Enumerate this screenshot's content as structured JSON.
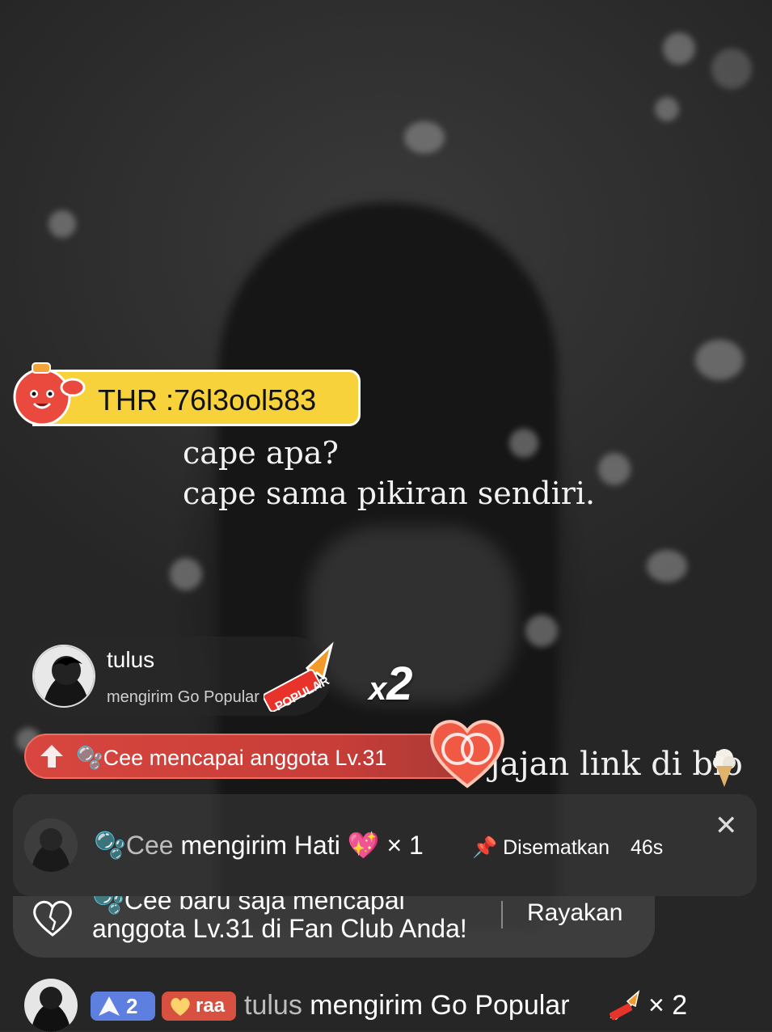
{
  "banner": {
    "text": "THR :76l3ool583"
  },
  "stream_caption": {
    "line1": "cape apa?",
    "line2": "cape sama pikiran sendiri.",
    "promo": "traktir jajan link di bio"
  },
  "gift_card": {
    "username": "tulus",
    "action": "mengirim Go Popular",
    "multiplier": "2",
    "multiplier_prefix": "x",
    "sticker_text": "POPULAR"
  },
  "level_up": {
    "text": "Cee mencapai anggota Lv.31"
  },
  "pinned": {
    "name": "Cee",
    "action": "mengirim Hati",
    "count": "× 1",
    "pinned_label": "Disematkan",
    "time": "46s"
  },
  "fan_club": {
    "line1": "Cee baru saja mencapai",
    "line2": "anggota Lv.31 di Fan Club Anda!",
    "button": "Rayakan"
  },
  "chat": {
    "level": "2",
    "fan_badge": "raa",
    "name": "tulus",
    "action": "mengirim Go Popular",
    "count": "× 2"
  }
}
